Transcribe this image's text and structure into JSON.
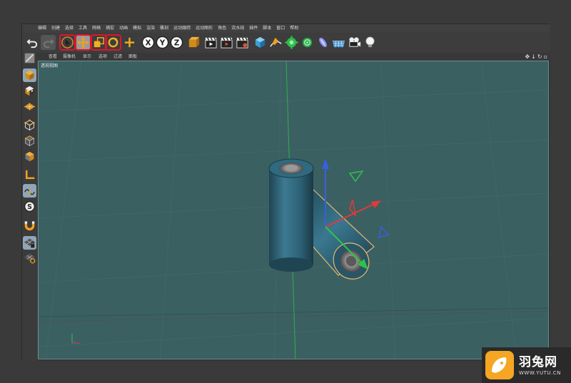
{
  "menu": [
    "编辑",
    "创建",
    "选择",
    "工具",
    "网格",
    "捕捉",
    "动画",
    "模拟",
    "渲染",
    "雕刻",
    "运动跟踪",
    "运动图形",
    "角色",
    "流水线",
    "插件",
    "脚本",
    "窗口",
    "帮助"
  ],
  "toolbar": {
    "axis_x": "X",
    "axis_y": "Y",
    "axis_z": "Z"
  },
  "viewport_menu": [
    "查看",
    "摄像机",
    "显示",
    "选项",
    "过滤",
    "面板"
  ],
  "viewport_label": "透视视图",
  "palette": {
    "snap_label": "S"
  },
  "watermark": {
    "title": "羽兔网",
    "url": "WWW.YUTU.CN"
  },
  "colors": {
    "viewport_bg": "#3b6062",
    "cylinder": "#2f5e73",
    "axis_x": "#e23a3a",
    "axis_y": "#2ec24a",
    "axis_z": "#3a5ee0",
    "selection_outline": "#e0152c",
    "watermark_accent": "#f5a623"
  }
}
